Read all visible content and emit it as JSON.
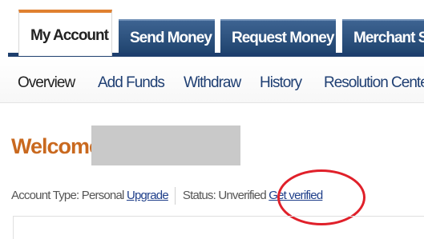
{
  "tabs": [
    {
      "label": "My Account",
      "active": true
    },
    {
      "label": "Send Money",
      "active": false
    },
    {
      "label": "Request Money",
      "active": false
    },
    {
      "label": "Merchant Se",
      "active": false
    }
  ],
  "subnav": {
    "items": [
      {
        "label": "Overview",
        "active": true
      },
      {
        "label": "Add Funds",
        "active": false
      },
      {
        "label": "Withdraw",
        "active": false
      },
      {
        "label": "History",
        "active": false
      },
      {
        "label": "Resolution Cente",
        "active": false
      }
    ]
  },
  "welcome": {
    "text": "Welcome,"
  },
  "account": {
    "type_label": "Account Type: Personal",
    "upgrade_link": "Upgrade",
    "status_label": "Status: Unverified",
    "get_verified_link": "Get verified"
  },
  "colors": {
    "tab_blue": "#20446f",
    "active_tab_accent": "#e08030",
    "link_blue": "#1f3f8a",
    "welcome_orange": "#c9691f",
    "annotation_red": "#e0202a"
  }
}
